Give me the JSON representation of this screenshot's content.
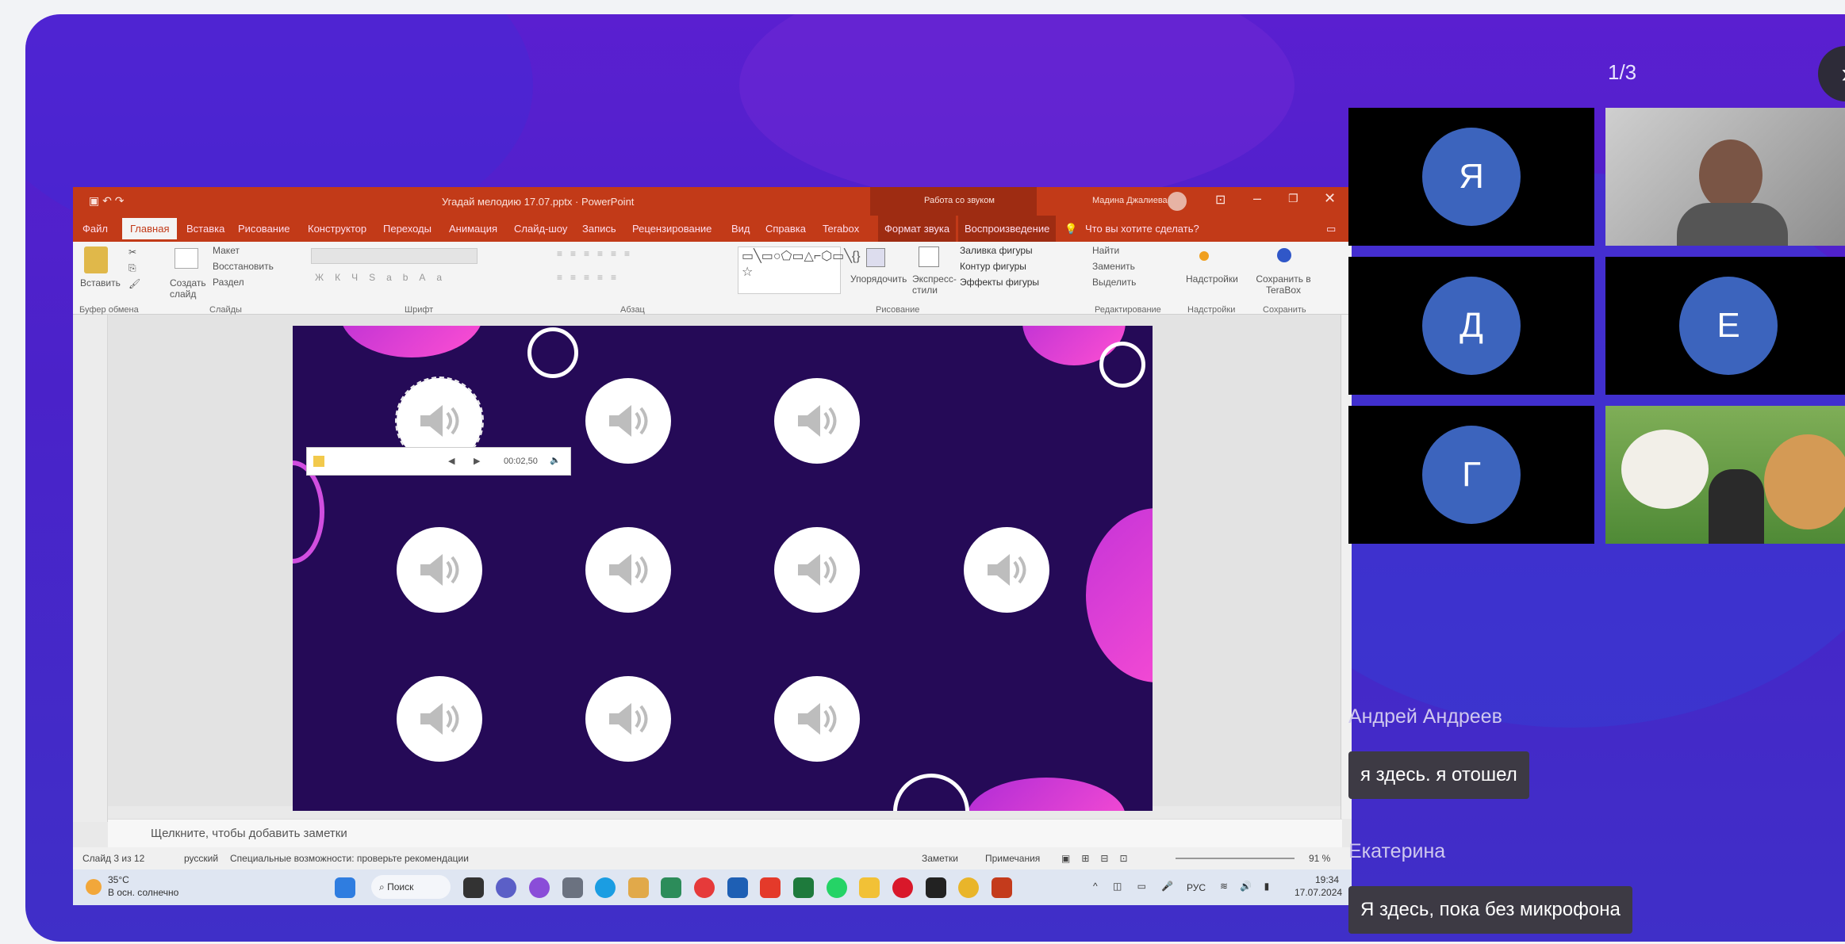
{
  "meeting": {
    "pager": "1/3",
    "participants": [
      {
        "initial": "Я"
      },
      {
        "initial": "Д"
      },
      {
        "initial": "Е"
      },
      {
        "initial": "Г"
      }
    ],
    "chat": [
      {
        "author": "Андрей Андреев",
        "text": "я здесь. я отошел"
      },
      {
        "author": "Екатерина",
        "text": "Я здесь, пока без микрофона"
      }
    ]
  },
  "ppt": {
    "title": "Угадай мелодию 17.07.pptx · PowerPoint",
    "context_label": "Работа со звуком",
    "user": "Мадина Джалиева",
    "tabs": [
      "Файл",
      "Главная",
      "Вставка",
      "Рисование",
      "Конструктор",
      "Переходы",
      "Анимация",
      "Слайд-шоу",
      "Запись",
      "Рецензирование",
      "Вид",
      "Справка",
      "Terabox",
      "Формат звука",
      "Воспроизведение"
    ],
    "tell_me": "Что вы хотите сделать?",
    "ribbon": {
      "paste": "Вставить",
      "create_slide": "Создать слайд",
      "layout": "Макет",
      "restore": "Восстановить",
      "section": "Раздел",
      "arrange": "Упорядочить",
      "express_styles": "Экспресс-стили",
      "shape_fill": "Заливка фигуры",
      "shape_outline": "Контур фигуры",
      "shape_effects": "Эффекты фигуры",
      "find": "Найти",
      "replace": "Заменить",
      "select": "Выделить",
      "addins": "Надстройки",
      "save_terabox": "Сохранить в TeraBox",
      "groups": [
        "Буфер обмена",
        "Слайды",
        "Шрифт",
        "Абзац",
        "Рисование",
        "Редактирование",
        "Надстройки",
        "Сохранить"
      ]
    },
    "player_time": "00:02,50",
    "notes_placeholder": "Щелкните, чтобы добавить заметки",
    "status": {
      "slide": "Слайд 3 из 12",
      "language": "русский",
      "accessibility": "Специальные возможности: проверьте рекомендации",
      "notes": "Заметки",
      "comments": "Примечания",
      "zoom": "91 %"
    },
    "taskbar": {
      "weather_temp": "35°C",
      "weather_desc": "В осн. солнечно",
      "search": "Поиск",
      "lang": "РУС",
      "time": "19:34",
      "date": "17.07.2024"
    }
  }
}
